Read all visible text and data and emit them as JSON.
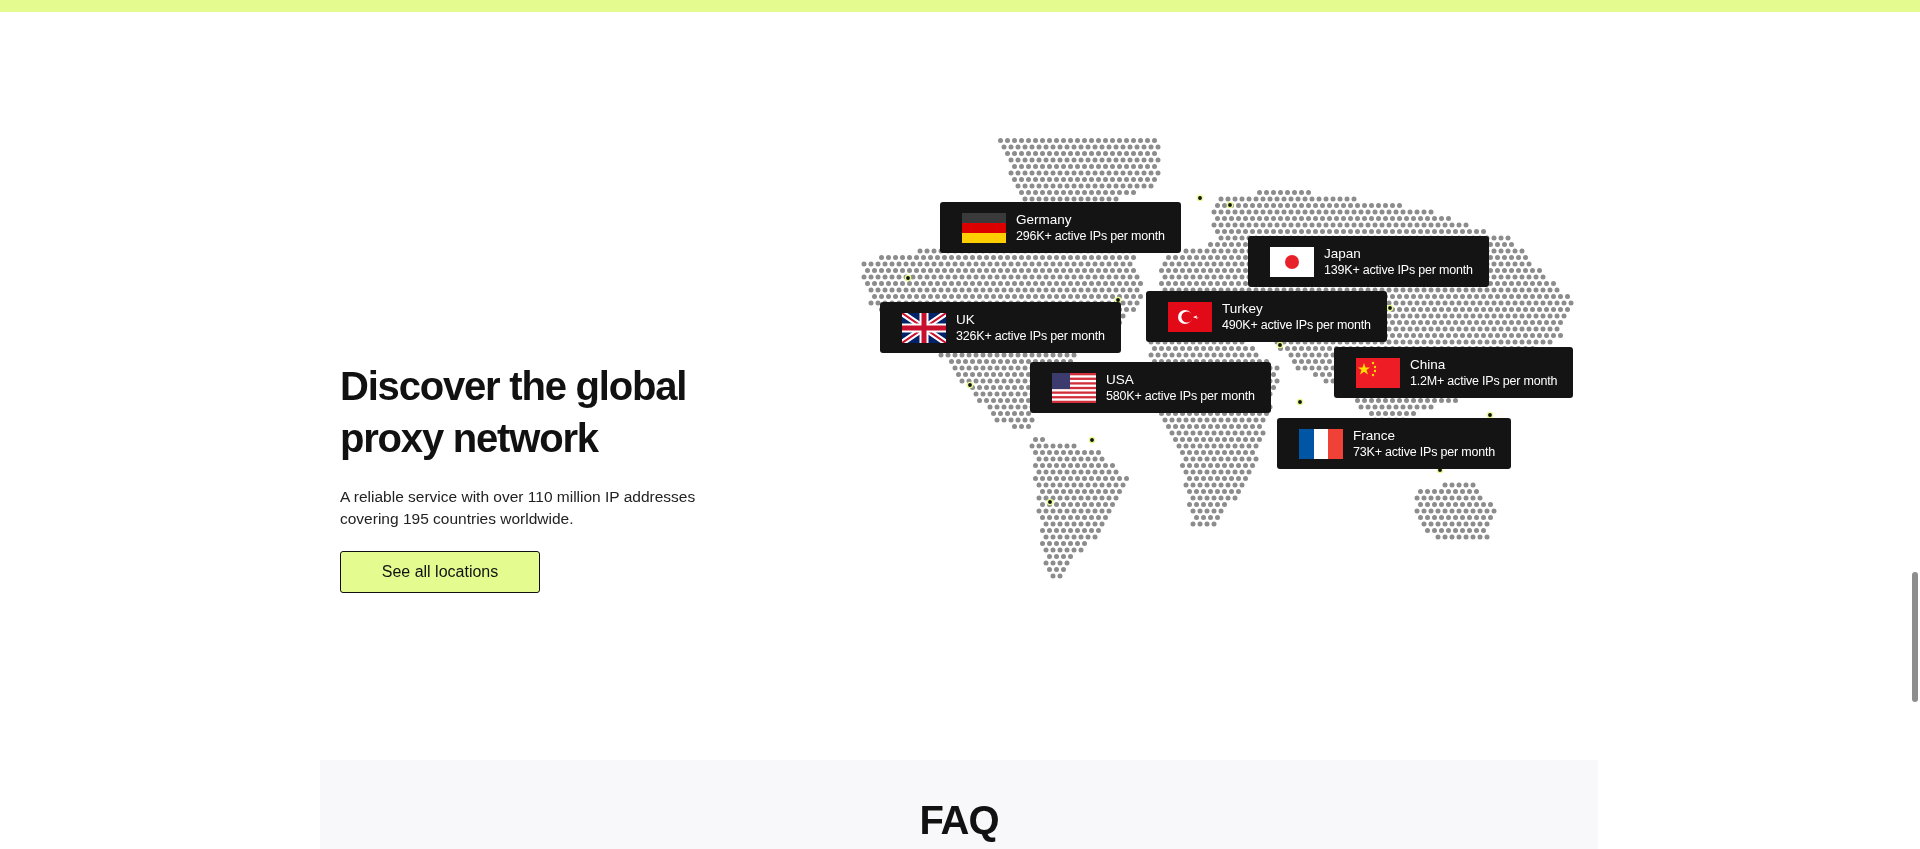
{
  "hero": {
    "title": "Discover the global proxy network",
    "description": "A reliable service with over 110 million IP addresses covering 195 countries worldwide.",
    "button": "See all locations"
  },
  "locations": [
    {
      "country": "Germany",
      "stat": "296K+ active IPs per month"
    },
    {
      "country": "Japan",
      "stat": "139K+ active IPs per month"
    },
    {
      "country": "UK",
      "stat": "326K+ active IPs per month"
    },
    {
      "country": "Turkey",
      "stat": "490K+ active IPs per month"
    },
    {
      "country": "USA",
      "stat": "580K+ active IPs per month"
    },
    {
      "country": "China",
      "stat": "1.2M+ active IPs per month"
    },
    {
      "country": "France",
      "stat": "73K+ active IPs per month"
    }
  ],
  "faq": {
    "title": "FAQ"
  }
}
